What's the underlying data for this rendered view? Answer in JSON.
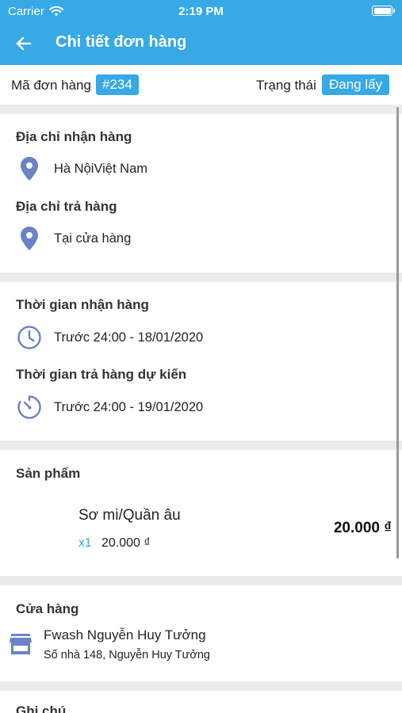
{
  "status_bar": {
    "carrier": "Carrier",
    "time": "2:19 PM"
  },
  "header": {
    "title": "Chi tiết đơn hàng",
    "back_icon": "arrow-left-icon"
  },
  "order": {
    "code_label": "Mã đơn hàng",
    "code": "#234",
    "status_label": "Trạng thái",
    "status": "Đang lấy"
  },
  "addresses": {
    "pickup_title": "Địa chỉ nhận hàng",
    "pickup_value": "Hà NộiViệt Nam",
    "dropoff_title": "Địa chỉ trả hàng",
    "dropoff_value": "Tại cửa hàng",
    "icon": "map-pin-icon"
  },
  "times": {
    "pickup_title": "Thời gian nhận hàng",
    "pickup_value": "Trước 24:00 -  18/01/2020",
    "return_title": "Thời gian trả hàng dự kiến",
    "return_value": "Trước 24:00 -  19/01/2020"
  },
  "products": {
    "title": "Sản phẩm",
    "items": [
      {
        "name": "Sơ mi/Quần âu",
        "quantity": "x1",
        "unit_price": "20.000 ₫",
        "total": "20.000 ₫"
      }
    ]
  },
  "store": {
    "title": "Cửa hàng",
    "name": "Fwash Nguyễn Huy Tưởng",
    "address": "Số nhà 148, Nguyễn Huy Tưởng"
  },
  "note": {
    "title": "Ghi chú"
  },
  "colors": {
    "accent": "#36a9e6",
    "icon": "#6b82c4",
    "separator": "#ececec"
  }
}
